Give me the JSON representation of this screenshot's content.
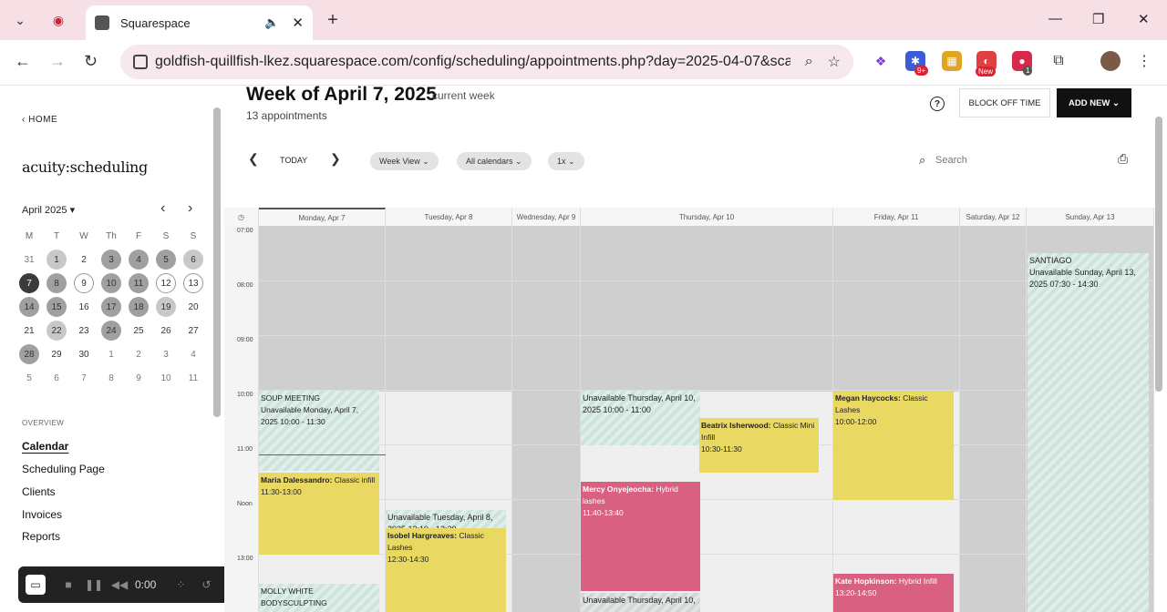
{
  "browser": {
    "tab_title": "Squarespace",
    "url": "goldfish-quillfish-lkez.squarespace.com/config/scheduling/appointments.php?day=2025-04-07&scal...",
    "ext_badge_1": "9+",
    "ext_badge_2": "New",
    "ext_badge_3": "1"
  },
  "sidebar": {
    "home": "HOME",
    "brand": "acuity:scheduling",
    "month": "April 2025",
    "weekdays": [
      "M",
      "T",
      "W",
      "Th",
      "F",
      "S",
      "S"
    ],
    "weeks": [
      [
        "31",
        "1",
        "2",
        "3",
        "4",
        "5",
        "6"
      ],
      [
        "7",
        "8",
        "9",
        "10",
        "11",
        "12",
        "13"
      ],
      [
        "14",
        "15",
        "16",
        "17",
        "18",
        "19",
        "20"
      ],
      [
        "21",
        "22",
        "23",
        "24",
        "25",
        "26",
        "27"
      ],
      [
        "28",
        "29",
        "30",
        "1",
        "2",
        "3",
        "4"
      ],
      [
        "5",
        "6",
        "7",
        "8",
        "9",
        "10",
        "11"
      ]
    ],
    "overview": "OVERVIEW",
    "nav": [
      "Calendar",
      "Scheduling Page",
      "Clients",
      "Invoices",
      "Reports"
    ]
  },
  "recorder": {
    "time": "0:00"
  },
  "header": {
    "title": "Week of April 7, 2025",
    "current": "current week",
    "count": "13 appointments",
    "block_off": "BLOCK OFF TIME",
    "add_new": "ADD NEW",
    "today": "TODAY",
    "view": "Week View",
    "calendars": "All calendars",
    "zoom": "1x",
    "search_placeholder": "Search"
  },
  "days": [
    "Monday, Apr 7",
    "Tuesday, Apr 8",
    "Wednesday, Apr 9",
    "Thursday, Apr 10",
    "Friday, Apr 11",
    "Saturday, Apr 12",
    "Sunday, Apr 13"
  ],
  "times": [
    "07:00",
    "08:00",
    "09:00",
    "10:00",
    "11:00",
    "Noon",
    "13:00"
  ],
  "events": {
    "soup": {
      "title": "SOUP MEETING",
      "desc": "Unavailable Monday, April 7, 2025 10:00 - 11:30"
    },
    "maria": {
      "name": "Maria Dalessandro:",
      "svc": "Classic infill",
      "time": "11:30-13:00"
    },
    "molly": {
      "title": "MOLLY WHITE BODYSCULPTING"
    },
    "tue_unavail": {
      "desc": "Unavailable Tuesday, April 8, 2025 12:10 - 12:30"
    },
    "isobel": {
      "name": "Isobel Hargreaves:",
      "svc": "Classic Lashes",
      "time": "12:30-14:30"
    },
    "thu_unavail": {
      "desc": "Unavailable Thursday, April 10, 2025 10:00 - 11:00"
    },
    "beatrix": {
      "name": "Beatrix Isherwood:",
      "svc": "Classic Mini Infill",
      "time": "10:30-11:30"
    },
    "mercy": {
      "name": "Mercy Onyejeocha:",
      "svc": "Hybrid lashes",
      "time": "11:40-13:40"
    },
    "thu_unavail2": {
      "desc": "Unavailable Thursday, April 10,"
    },
    "megan": {
      "name": "Megan Haycocks:",
      "svc": "Classic Lashes",
      "time": "10:00-12:00"
    },
    "kate": {
      "name": "Kate Hopkinson:",
      "svc": "Hybrid Infill",
      "time": "13:20-14:50"
    },
    "santiago": {
      "title": "SANTIAGO",
      "desc": "Unavailable Sunday, April 13, 2025 07:30 - 14:30"
    }
  },
  "colors": {
    "appointment_yellow": "#e9d862",
    "appointment_pink": "#d96080",
    "unavailable": "#cde3dc"
  }
}
